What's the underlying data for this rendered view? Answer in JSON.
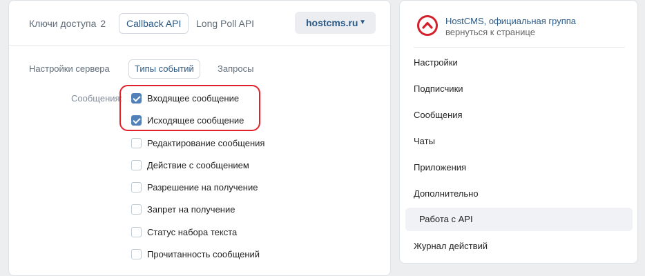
{
  "top_tabs": [
    {
      "label": "Ключи доступа",
      "count": "2"
    },
    {
      "label": "Callback API"
    },
    {
      "label": "Long Poll API"
    }
  ],
  "server_dropdown": {
    "value": "hostcms.ru"
  },
  "sub_tabs": [
    {
      "label": "Настройки сервера"
    },
    {
      "label": "Типы событий"
    },
    {
      "label": "Запросы"
    }
  ],
  "messages_section": {
    "label": "Сообщения:",
    "checkboxes": [
      {
        "label": "Входящее сообщение",
        "checked": true
      },
      {
        "label": "Исходящее сообщение",
        "checked": true
      },
      {
        "label": "Редактирование сообщения",
        "checked": false
      },
      {
        "label": "Действие с сообщением",
        "checked": false
      },
      {
        "label": "Разрешение на получение",
        "checked": false
      },
      {
        "label": "Запрет на получение",
        "checked": false
      },
      {
        "label": "Статус набора текста",
        "checked": false
      },
      {
        "label": "Прочитанность сообщений",
        "checked": false
      }
    ]
  },
  "sidebar": {
    "group_name": "HostCMS, официальная группа",
    "back_link": "вернуться к странице",
    "menu": [
      {
        "label": "Настройки"
      },
      {
        "label": "Подписчики"
      },
      {
        "label": "Сообщения"
      },
      {
        "label": "Чаты"
      },
      {
        "label": "Приложения"
      },
      {
        "label": "Дополнительно"
      },
      {
        "label": "Работа с API",
        "active": true
      },
      {
        "label": "Журнал действий"
      }
    ]
  },
  "colors": {
    "accent": "#2a5885",
    "checkbox": "#5181b8",
    "highlight": "#e2212b",
    "logo": "#d4202c"
  }
}
